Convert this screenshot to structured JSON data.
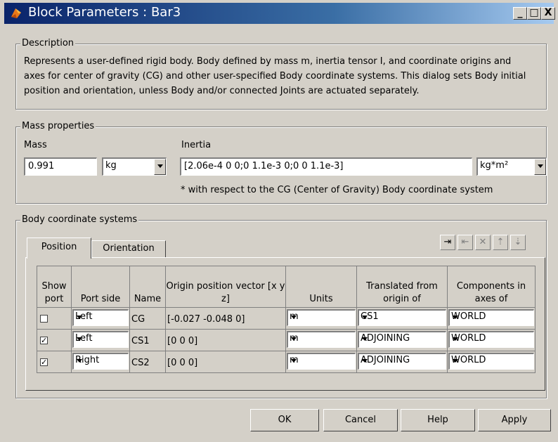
{
  "window": {
    "title": "Block Parameters : Bar3",
    "minimize": "_",
    "maximize": "□",
    "close": "X"
  },
  "description": {
    "legend": "Description",
    "text": "Represents a user-defined rigid body. Body defined by mass m, inertia tensor I, and coordinate origins and axes for center of gravity (CG) and other user-specified Body coordinate systems. This dialog sets Body initial position and orientation, unless Body and/or connected Joints are actuated separately."
  },
  "mass_properties": {
    "legend": "Mass properties",
    "mass_label": "Mass",
    "mass_value": "0.991",
    "mass_unit": "kg",
    "inertia_label": "Inertia",
    "inertia_value": "[2.06e-4 0 0;0 1.1e-3 0;0 0 1.1e-3]",
    "inertia_unit": "kg*m²",
    "note": "* with respect to the CG (Center of Gravity) Body coordinate system"
  },
  "body_cs": {
    "legend": "Body coordinate systems",
    "tabs": [
      "Position",
      "Orientation"
    ],
    "toolbar": [
      "⇥",
      "⇤",
      "✕",
      "⇡",
      "⇣"
    ],
    "columns": {
      "show_port": "Show port",
      "port_side": "Port side",
      "name": "Name",
      "origin": "Origin position vector [x y z]",
      "units": "Units",
      "translated": "Translated from origin of",
      "components": "Components in axes of"
    },
    "rows": [
      {
        "checked": "",
        "port_side": "Left",
        "name": "CG",
        "origin": "[-0.027 -0.048 0]",
        "units": "m",
        "translated": "CS1",
        "components": "WORLD"
      },
      {
        "checked": "✓",
        "port_side": "Left",
        "name": "CS1",
        "origin": "[0 0 0]",
        "units": "m",
        "translated": "ADJOINING",
        "components": "WORLD"
      },
      {
        "checked": "✓",
        "port_side": "Right",
        "name": "CS2",
        "origin": "[0 0 0]",
        "units": "m",
        "translated": "ADJOINING",
        "components": "WORLD"
      }
    ]
  },
  "buttons": {
    "ok": "OK",
    "cancel": "Cancel",
    "help": "Help",
    "apply": "Apply"
  },
  "colors": {
    "title_start": "#0a246a",
    "title_end": "#a6caf0",
    "face": "#d4d0c8"
  }
}
